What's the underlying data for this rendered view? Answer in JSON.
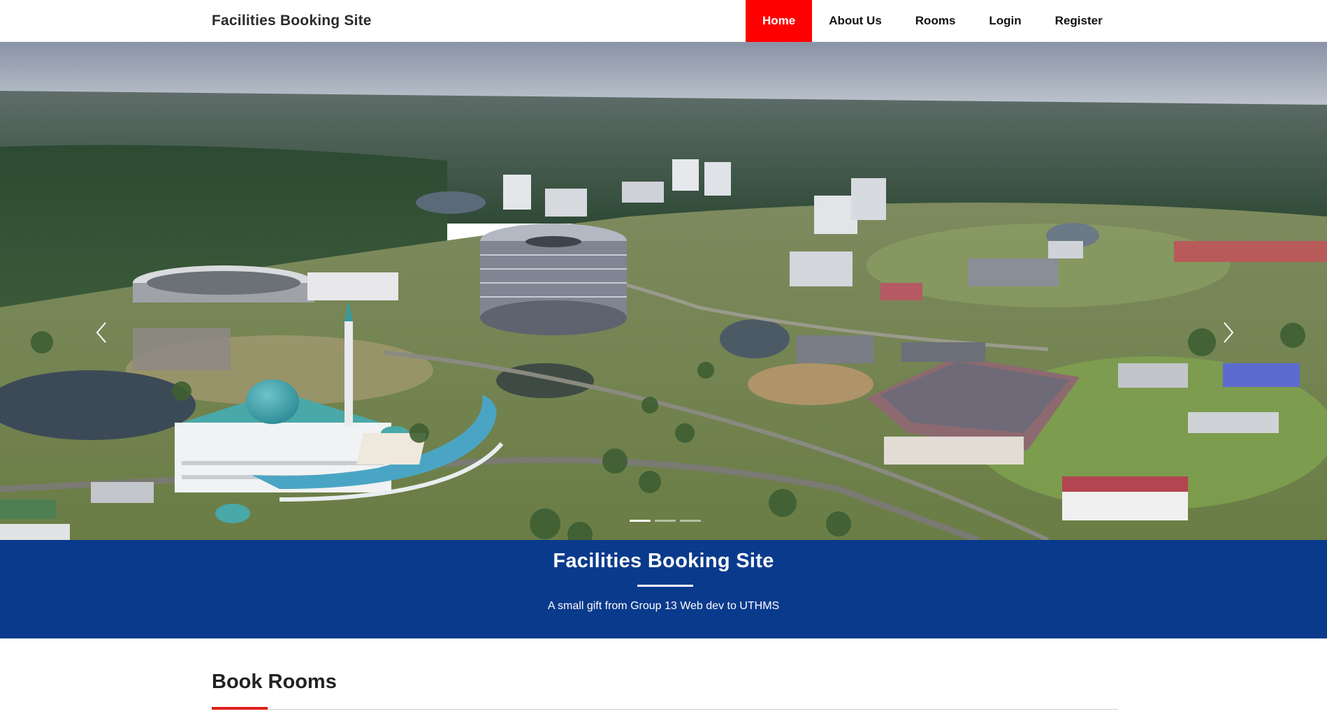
{
  "brand": "Facilities Booking Site",
  "nav": {
    "items": [
      {
        "label": "Home",
        "active": true
      },
      {
        "label": "About Us",
        "active": false
      },
      {
        "label": "Rooms",
        "active": false
      },
      {
        "label": "Login",
        "active": false
      },
      {
        "label": "Register",
        "active": false
      }
    ]
  },
  "carousel": {
    "prev_icon": "chevron-left-icon",
    "next_icon": "chevron-right-icon",
    "slide_count": 3,
    "active_slide": 1
  },
  "banner": {
    "title": "Facilities Booking Site",
    "subtitle": "A small gift from Group 13 Web dev to UTHMS"
  },
  "section": {
    "title": "Book Rooms"
  },
  "colors": {
    "nav_active_bg": "#ff0000",
    "banner_bg": "#0a3a8c",
    "accent": "#e0201b"
  }
}
